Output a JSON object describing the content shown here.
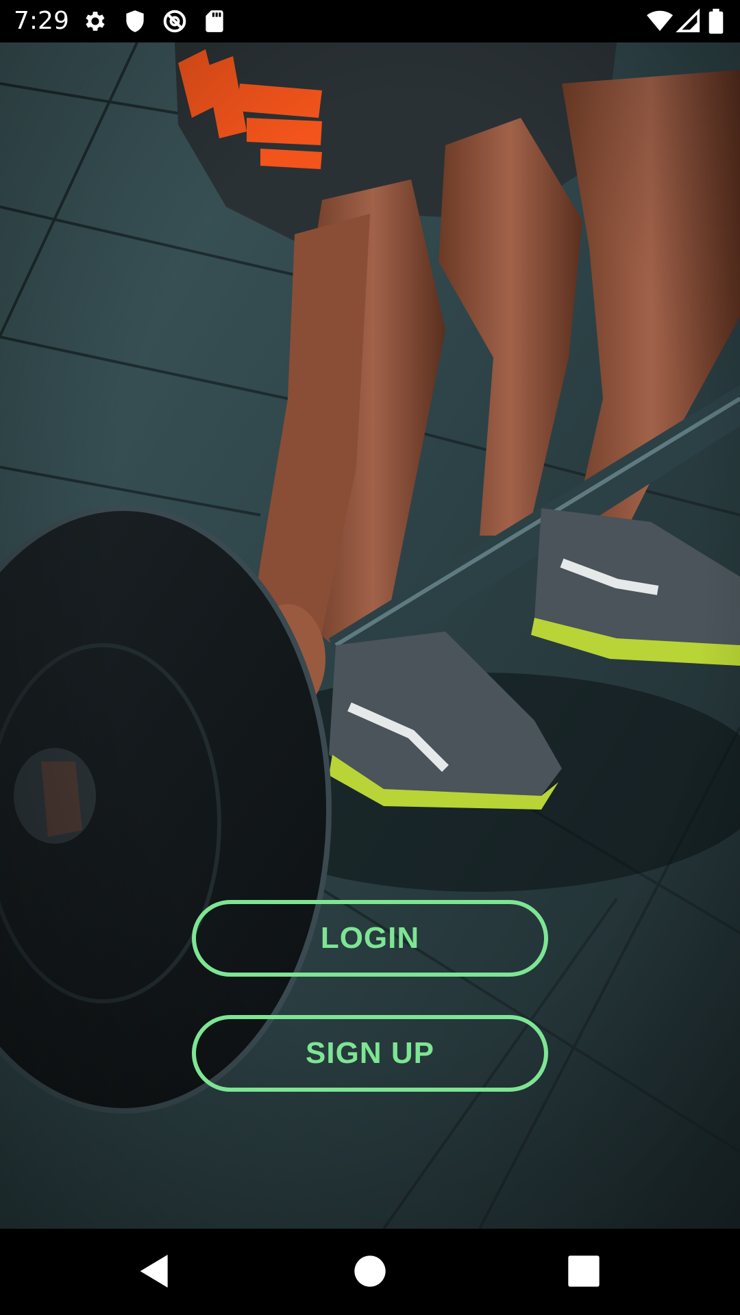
{
  "status_bar": {
    "time": "7:29",
    "icons": [
      "gear-icon",
      "shield-icon",
      "sync-disabled-icon",
      "sd-card-icon",
      "wifi-icon",
      "cell-signal-icon",
      "battery-icon"
    ]
  },
  "background": {
    "subject": "athlete-lifting-barbell-photo"
  },
  "buttons": {
    "login_label": "LOGIN",
    "signup_label": "SIGN UP"
  },
  "nav_bar": {
    "icons": [
      "back-icon",
      "home-icon",
      "recents-icon"
    ]
  },
  "colors": {
    "accent": "#7de593",
    "status_bar_bg": "#000000",
    "nav_bar_bg": "#000000"
  }
}
